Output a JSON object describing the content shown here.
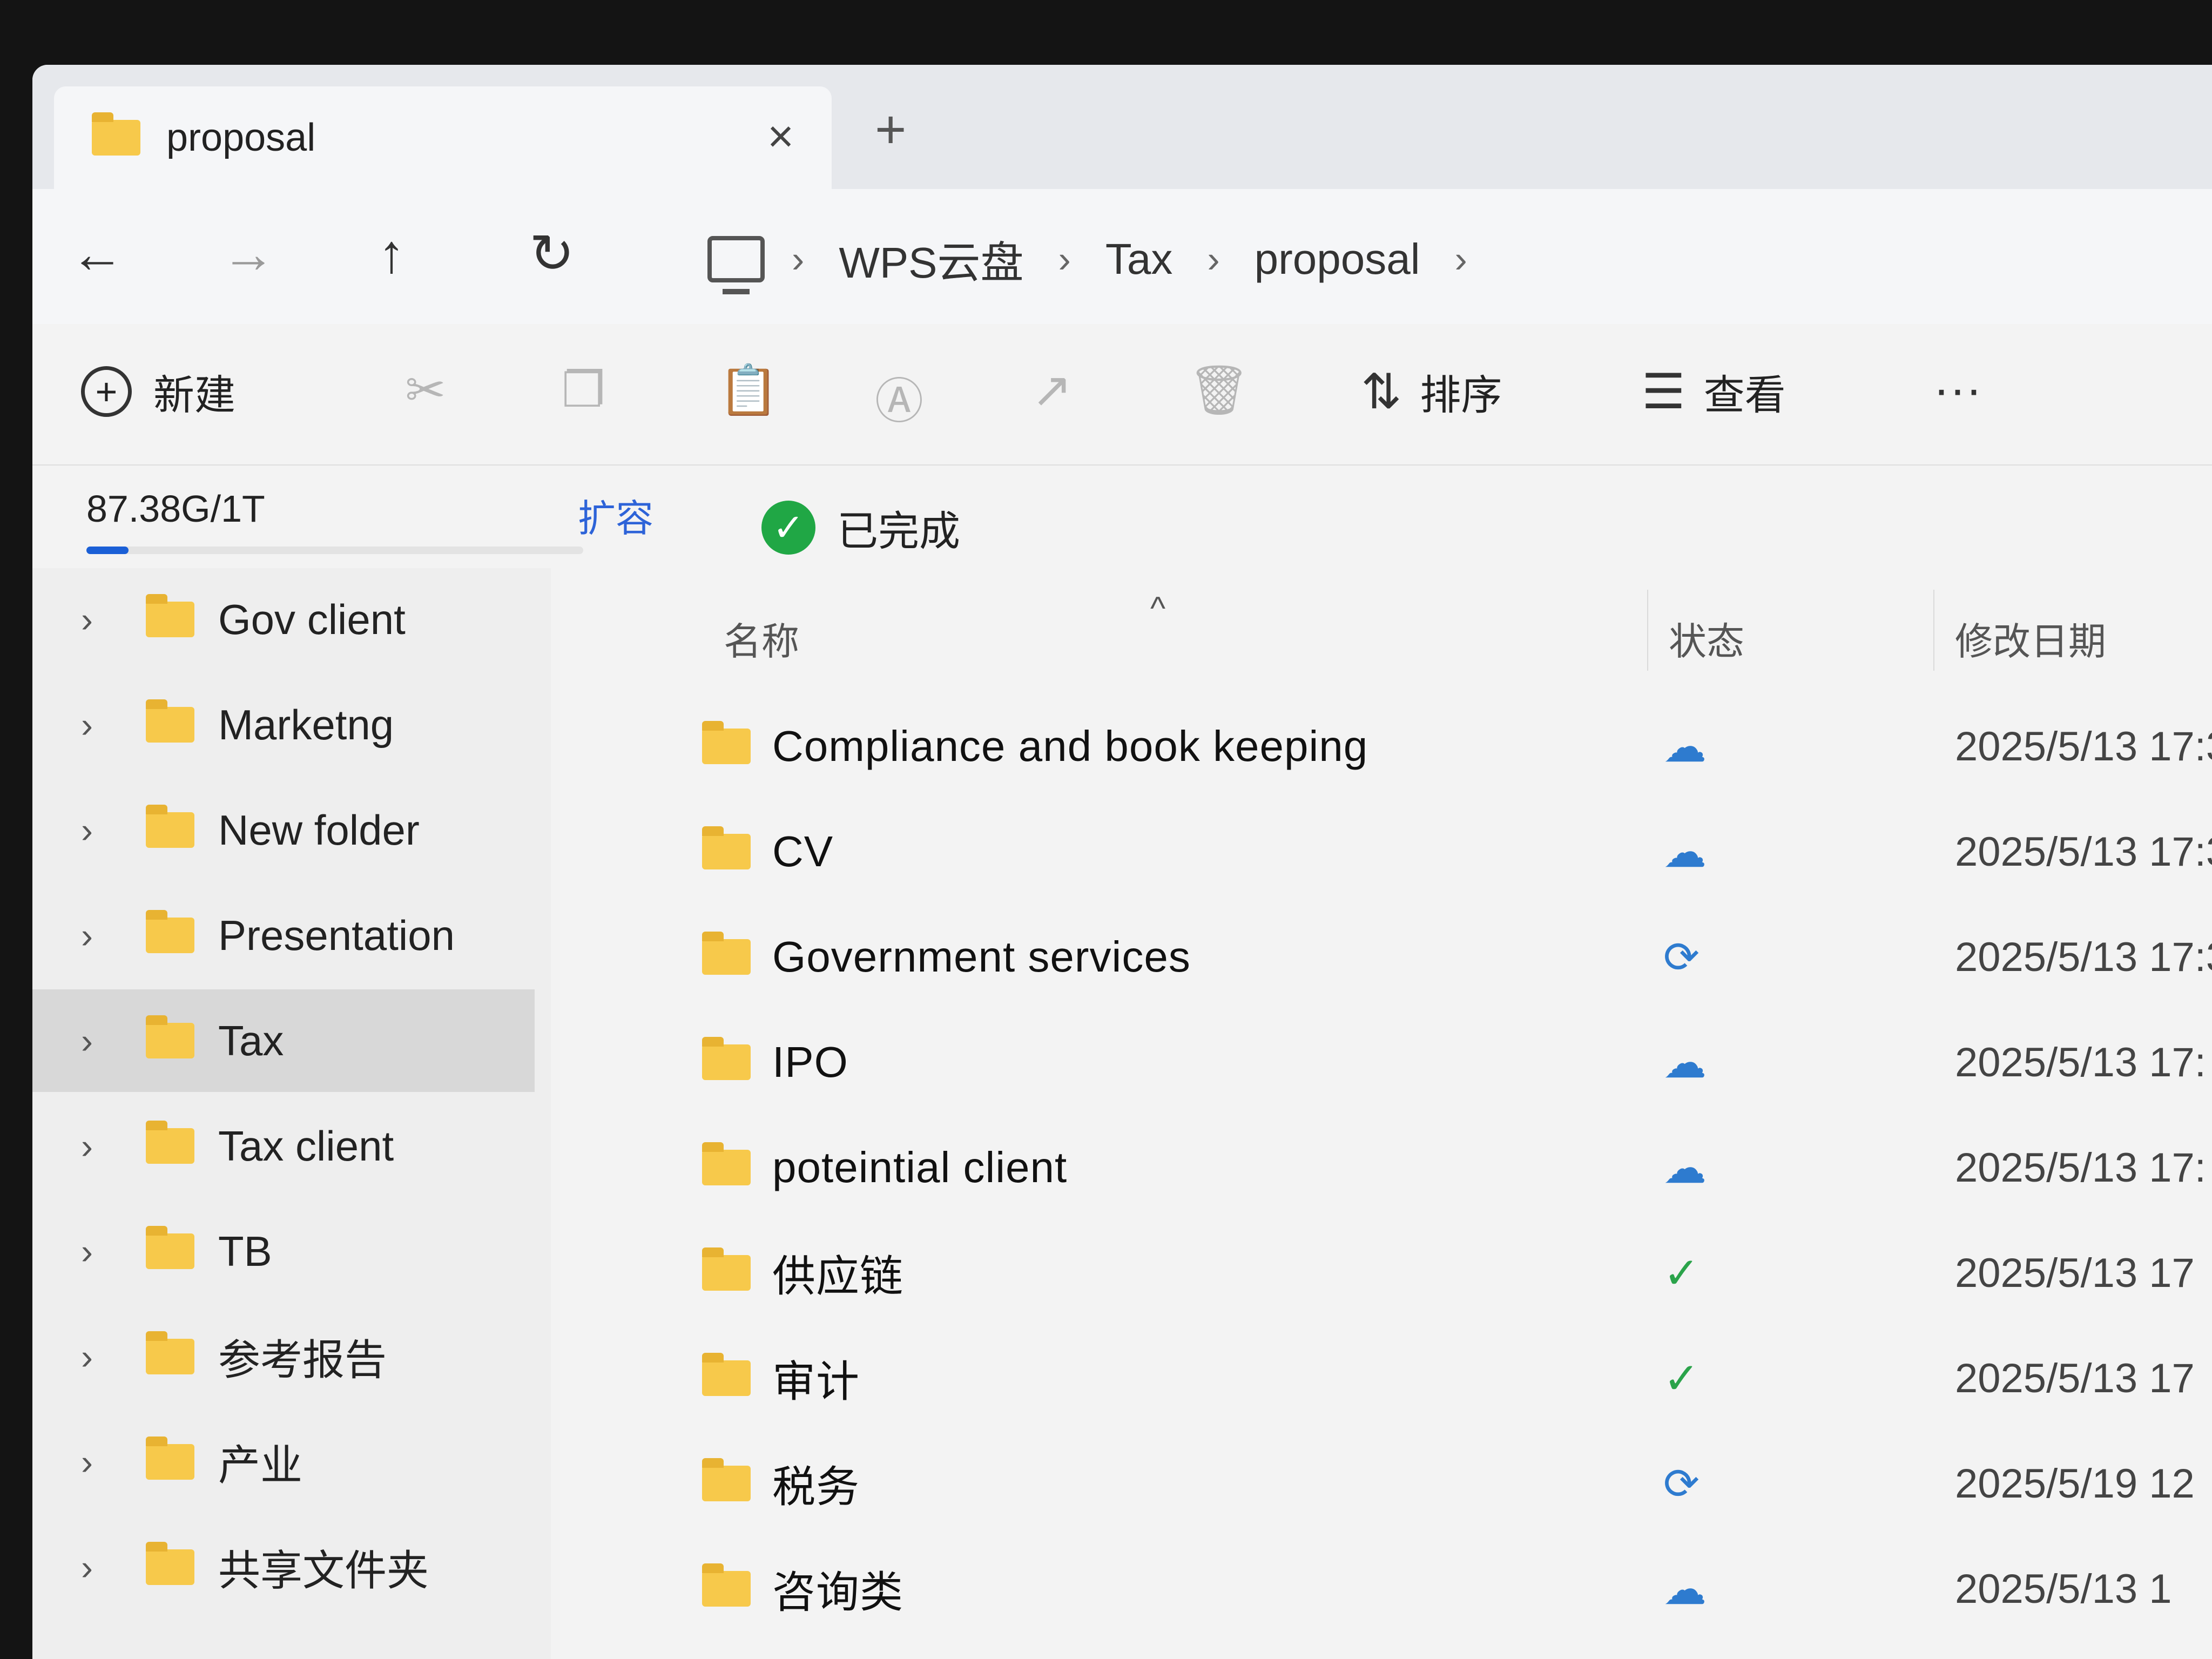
{
  "tab": {
    "title": "proposal",
    "close": "×",
    "new_tab": "+"
  },
  "nav": {
    "back": "←",
    "forward": "→",
    "up": "↑",
    "refresh": "↻",
    "breadcrumbs": [
      "WPS云盘",
      "Tax",
      "proposal"
    ],
    "separator": "›"
  },
  "toolbar": {
    "new_label": "新建",
    "sort_label": "排序",
    "view_label": "查看",
    "more": "···"
  },
  "storage": {
    "usage": "87.38G/1T",
    "used_fraction": 0.085,
    "expand_label": "扩容"
  },
  "sync_status": "已完成",
  "sidebar": {
    "items": [
      {
        "label": "Gov client"
      },
      {
        "label": "Marketng"
      },
      {
        "label": "New folder"
      },
      {
        "label": "Presentation"
      },
      {
        "label": "Tax",
        "selected": true
      },
      {
        "label": "Tax client"
      },
      {
        "label": "TB"
      },
      {
        "label": "参考报告"
      },
      {
        "label": "产业"
      },
      {
        "label": "共享文件夹"
      }
    ]
  },
  "columns": {
    "name": "名称",
    "status": "状态",
    "modified": "修改日期"
  },
  "files": [
    {
      "name": "Compliance and book keeping",
      "status": "cloud",
      "date": "2025/5/13 17:3"
    },
    {
      "name": "CV",
      "status": "cloud",
      "date": "2025/5/13 17:3"
    },
    {
      "name": "Government services",
      "status": "syncing",
      "date": "2025/5/13 17:3"
    },
    {
      "name": "IPO",
      "status": "cloud",
      "date": "2025/5/13 17:"
    },
    {
      "name": "poteintial client",
      "status": "cloud",
      "date": "2025/5/13 17:"
    },
    {
      "name": "供应链",
      "status": "synced",
      "date": "2025/5/13 17"
    },
    {
      "name": "审计",
      "status": "synced",
      "date": "2025/5/13 17"
    },
    {
      "name": "税务",
      "status": "syncing",
      "date": "2025/5/19 12"
    },
    {
      "name": "咨询类",
      "status": "cloud",
      "date": "2025/5/13 1"
    }
  ],
  "status_icons": {
    "cloud": "☁",
    "syncing": "⟳",
    "synced": "✓"
  }
}
